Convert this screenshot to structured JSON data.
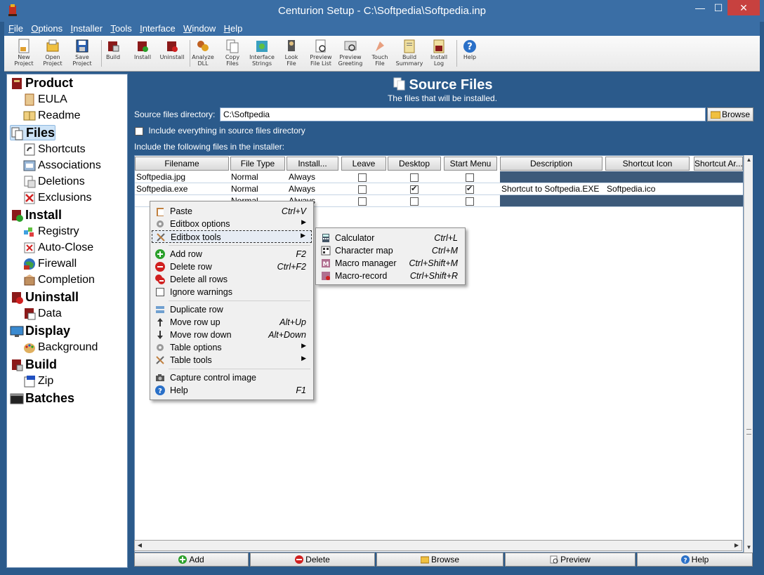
{
  "window": {
    "title": "Centurion Setup - C:\\Softpedia\\Softpedia.inp",
    "minimize_glyph": "—",
    "maximize_glyph": "☐",
    "close_glyph": "✕"
  },
  "menu": [
    {
      "key": "F",
      "rest": "ile"
    },
    {
      "key": "O",
      "rest": "ptions"
    },
    {
      "key": "I",
      "rest": "nstaller"
    },
    {
      "key": "T",
      "rest": "ools"
    },
    {
      "key": "I",
      "rest": "nterface"
    },
    {
      "key": "W",
      "rest": "indow"
    },
    {
      "key": "H",
      "rest": "elp"
    }
  ],
  "toolbar": {
    "new_project": [
      "New",
      "Project"
    ],
    "open_project": [
      "Open",
      "Project"
    ],
    "save_project": [
      "Save",
      "Project"
    ],
    "build": [
      "Build",
      ""
    ],
    "install": [
      "Install",
      ""
    ],
    "uninstall": [
      "Uninstall",
      ""
    ],
    "analyze_dll": [
      "Analyze",
      "DLL"
    ],
    "copy_files": [
      "Copy",
      "Files"
    ],
    "interface_strings": [
      "Interface",
      "Strings"
    ],
    "look_file": [
      "Look",
      "File"
    ],
    "preview_file_list": [
      "Preview",
      "File List"
    ],
    "preview_greeting": [
      "Preview",
      "Greeting"
    ],
    "touch_file": [
      "Touch",
      "File"
    ],
    "build_summary": [
      "Build",
      "Summary"
    ],
    "install_log": [
      "Install",
      "Log"
    ],
    "help": [
      "Help",
      ""
    ]
  },
  "tree": {
    "product": "Product",
    "eula": "EULA",
    "readme": "Readme",
    "files": "Files",
    "shortcuts": "Shortcuts",
    "associations": "Associations",
    "deletions": "Deletions",
    "exclusions": "Exclusions",
    "install": "Install",
    "registry": "Registry",
    "auto_close": "Auto-Close",
    "firewall": "Firewall",
    "completion": "Completion",
    "uninstall": "Uninstall",
    "data": "Data",
    "display": "Display",
    "background": "Background",
    "build": "Build",
    "zip": "Zip",
    "batches": "Batches"
  },
  "panel": {
    "title": "Source Files",
    "subtitle": "The files that will be installed.",
    "dir_label": "Source files directory:",
    "dir_value": "C:\\Softpedia",
    "browse": "Browse",
    "include_all_label": "Include everything in source files directory",
    "include_following_label": "Include the following files in the installer:"
  },
  "table": {
    "headers": {
      "filename": "Filename",
      "file_type": "File Type",
      "install": "Install...",
      "leave": "Leave",
      "desktop": "Desktop",
      "start_menu": "Start Menu",
      "description": "Description",
      "shortcut_icon": "Shortcut Icon",
      "shortcut_args": "Shortcut Ar..."
    },
    "rows": [
      {
        "filename": "Softpedia.jpg",
        "type": "Normal",
        "install": "Always",
        "leave": false,
        "desktop": false,
        "start_menu": false,
        "description": "",
        "icon": ""
      },
      {
        "filename": "Softpedia.exe",
        "type": "Normal",
        "install": "Always",
        "leave": false,
        "desktop": true,
        "start_menu": true,
        "description": "Shortcut to Softpedia.EXE",
        "icon": "Softpedia.ico"
      },
      {
        "filename": "",
        "type": "Normal",
        "install": "Always",
        "leave": false,
        "desktop": false,
        "start_menu": false,
        "description": "",
        "icon": ""
      }
    ]
  },
  "scroll": {
    "left": "◀",
    "right": "▶",
    "up": "▲",
    "down": "▼"
  },
  "bottom_buttons": {
    "add": "Add",
    "delete": "Delete",
    "browse": "Browse",
    "preview": "Preview",
    "help": "Help"
  },
  "context_menu": {
    "paste": {
      "label": "Paste",
      "shortcut": "Ctrl+V"
    },
    "editbox_options": {
      "label": "Editbox options"
    },
    "editbox_tools": {
      "label": "Editbox tools"
    },
    "add_row": {
      "label": "Add row",
      "shortcut": "F2"
    },
    "delete_row": {
      "label": "Delete row",
      "shortcut": "Ctrl+F2"
    },
    "delete_all_rows": {
      "label": "Delete all rows"
    },
    "ignore_warnings": {
      "label": "Ignore warnings"
    },
    "duplicate_row": {
      "label": "Duplicate row"
    },
    "move_row_up": {
      "label": "Move row up",
      "shortcut": "Alt+Up"
    },
    "move_row_down": {
      "label": "Move row down",
      "shortcut": "Alt+Down"
    },
    "table_options": {
      "label": "Table options"
    },
    "table_tools": {
      "label": "Table tools"
    },
    "capture_control_image": {
      "label": "Capture control image"
    },
    "help": {
      "label": "Help",
      "shortcut": "F1"
    },
    "submenu_arrow": "▶"
  },
  "submenu": {
    "calculator": {
      "label": "Calculator",
      "shortcut": "Ctrl+L"
    },
    "character_map": {
      "label": "Character map",
      "shortcut": "Ctrl+M"
    },
    "macro_manager": {
      "label": "Macro manager",
      "shortcut": "Ctrl+Shift+M"
    },
    "macro_record": {
      "label": "Macro-record",
      "shortcut": "Ctrl+Shift+R"
    }
  },
  "colors": {
    "titlebar": "#3a6ea5",
    "panel_bg": "#2b5a8b",
    "close_button": "#c7413f"
  }
}
